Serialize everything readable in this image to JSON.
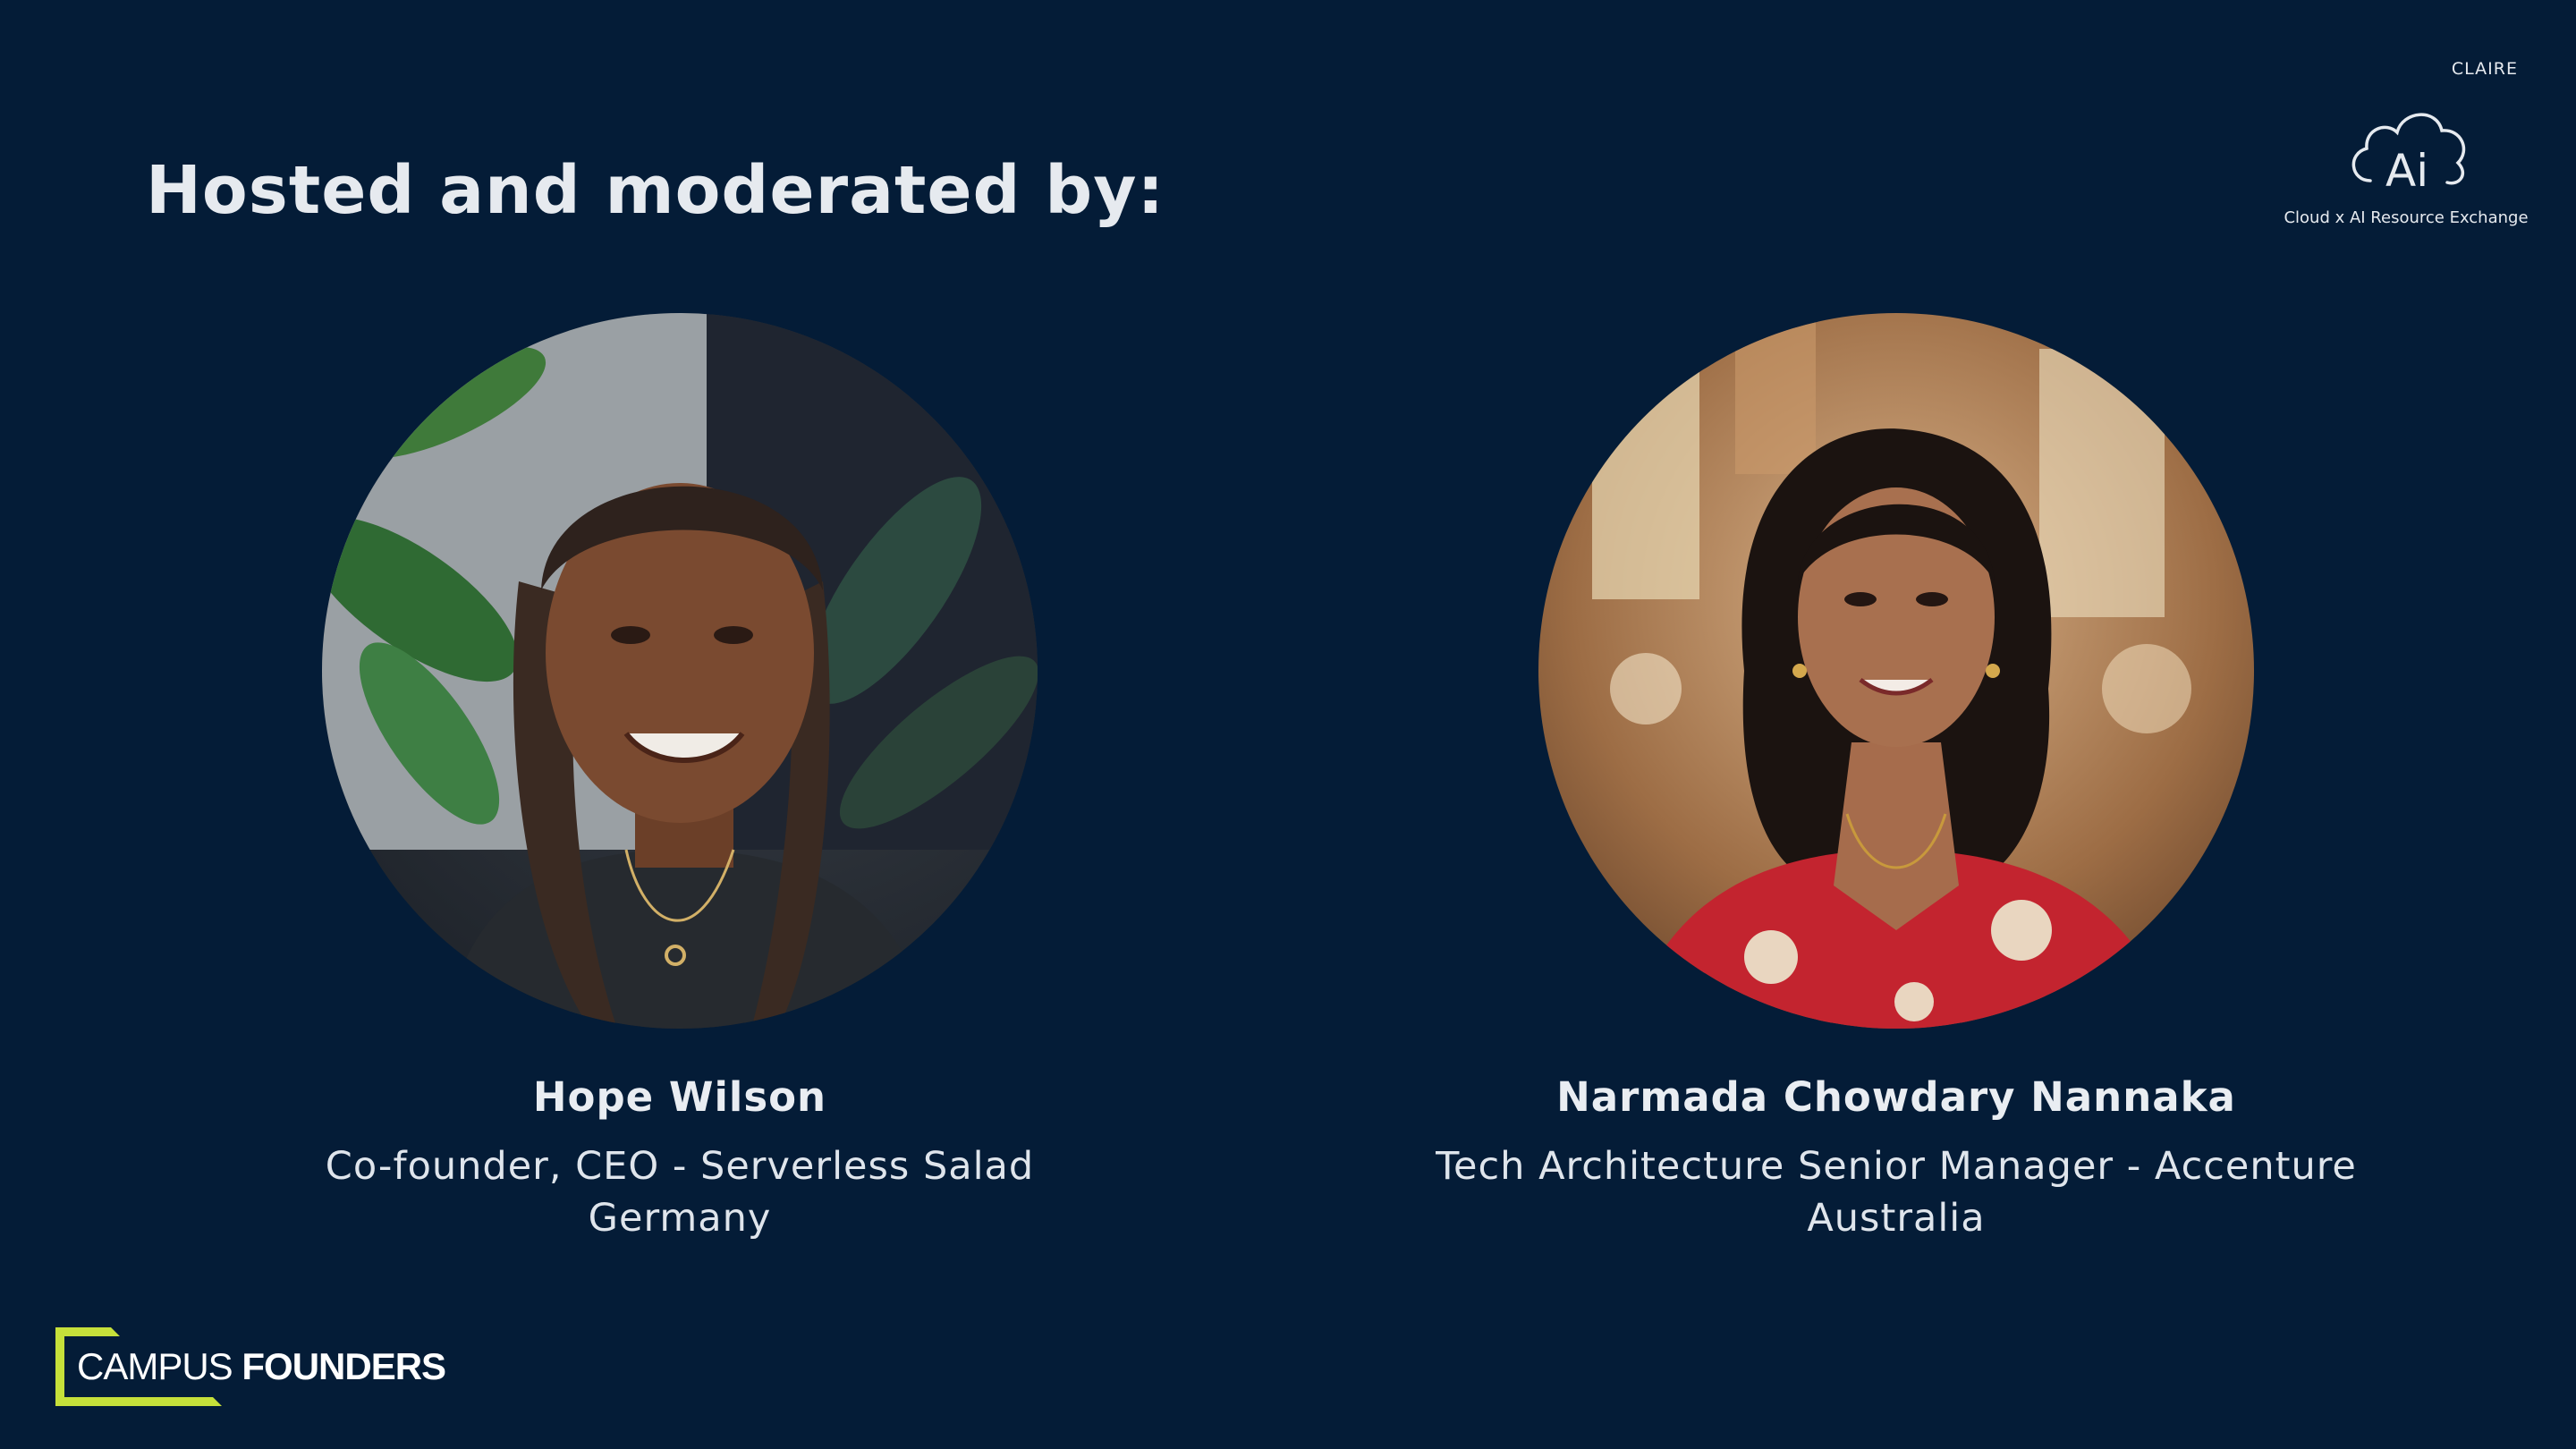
{
  "heading": "Hosted and moderated by:",
  "brand": {
    "wordmark": "CLAIRE",
    "logo_text": "Ai",
    "tagline": "Cloud x AI Resource Exchange",
    "icon": "cloud-ai-icon"
  },
  "hosts": [
    {
      "name": "Hope Wilson",
      "role": "Co-founder, CEO - Serverless Salad",
      "location": "Germany"
    },
    {
      "name": "Narmada Chowdary Nannaka",
      "role": "Tech Architecture Senior Manager - Accenture",
      "location": "Australia"
    }
  ],
  "footer_logo": {
    "light": "CAMPUS",
    "bold": "FOUNDERS",
    "accent_color": "#c6e03a"
  },
  "colors": {
    "background": "#041c37",
    "text": "#e6eaef"
  }
}
